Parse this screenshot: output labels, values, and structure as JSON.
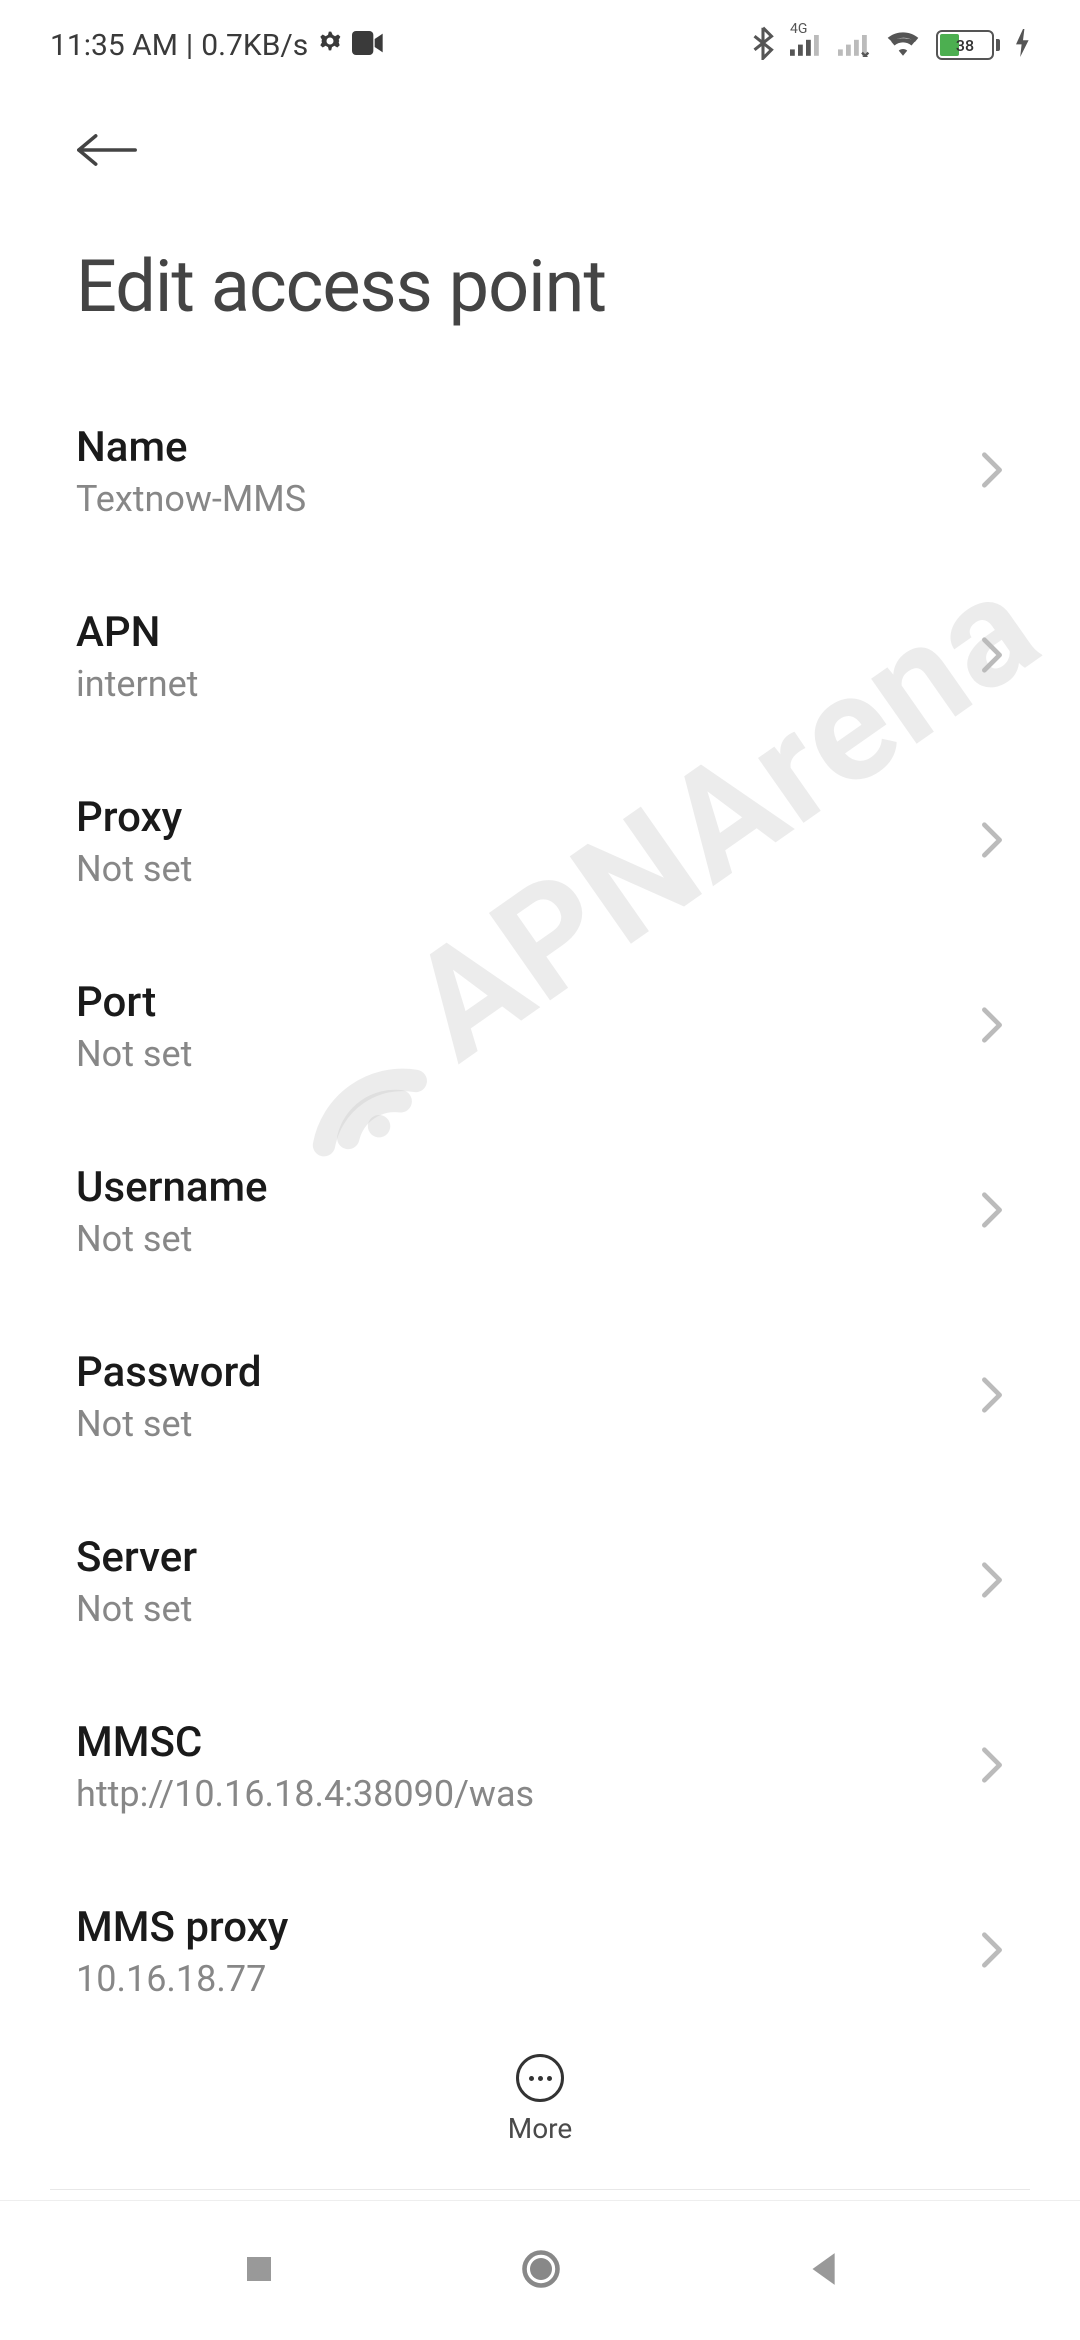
{
  "status_bar": {
    "time": "11:35 AM",
    "data_rate": "0.7KB/s",
    "network_label": "4G",
    "battery_percent": "38"
  },
  "header": {
    "title": "Edit access point"
  },
  "settings": [
    {
      "label": "Name",
      "value": "Textnow-MMS"
    },
    {
      "label": "APN",
      "value": "internet"
    },
    {
      "label": "Proxy",
      "value": "Not set"
    },
    {
      "label": "Port",
      "value": "Not set"
    },
    {
      "label": "Username",
      "value": "Not set"
    },
    {
      "label": "Password",
      "value": "Not set"
    },
    {
      "label": "Server",
      "value": "Not set"
    },
    {
      "label": "MMSC",
      "value": "http://10.16.18.4:38090/was"
    },
    {
      "label": "MMS proxy",
      "value": "10.16.18.77"
    }
  ],
  "bottom_action": {
    "more_label": "More"
  },
  "watermark": {
    "text": "APNArena"
  }
}
